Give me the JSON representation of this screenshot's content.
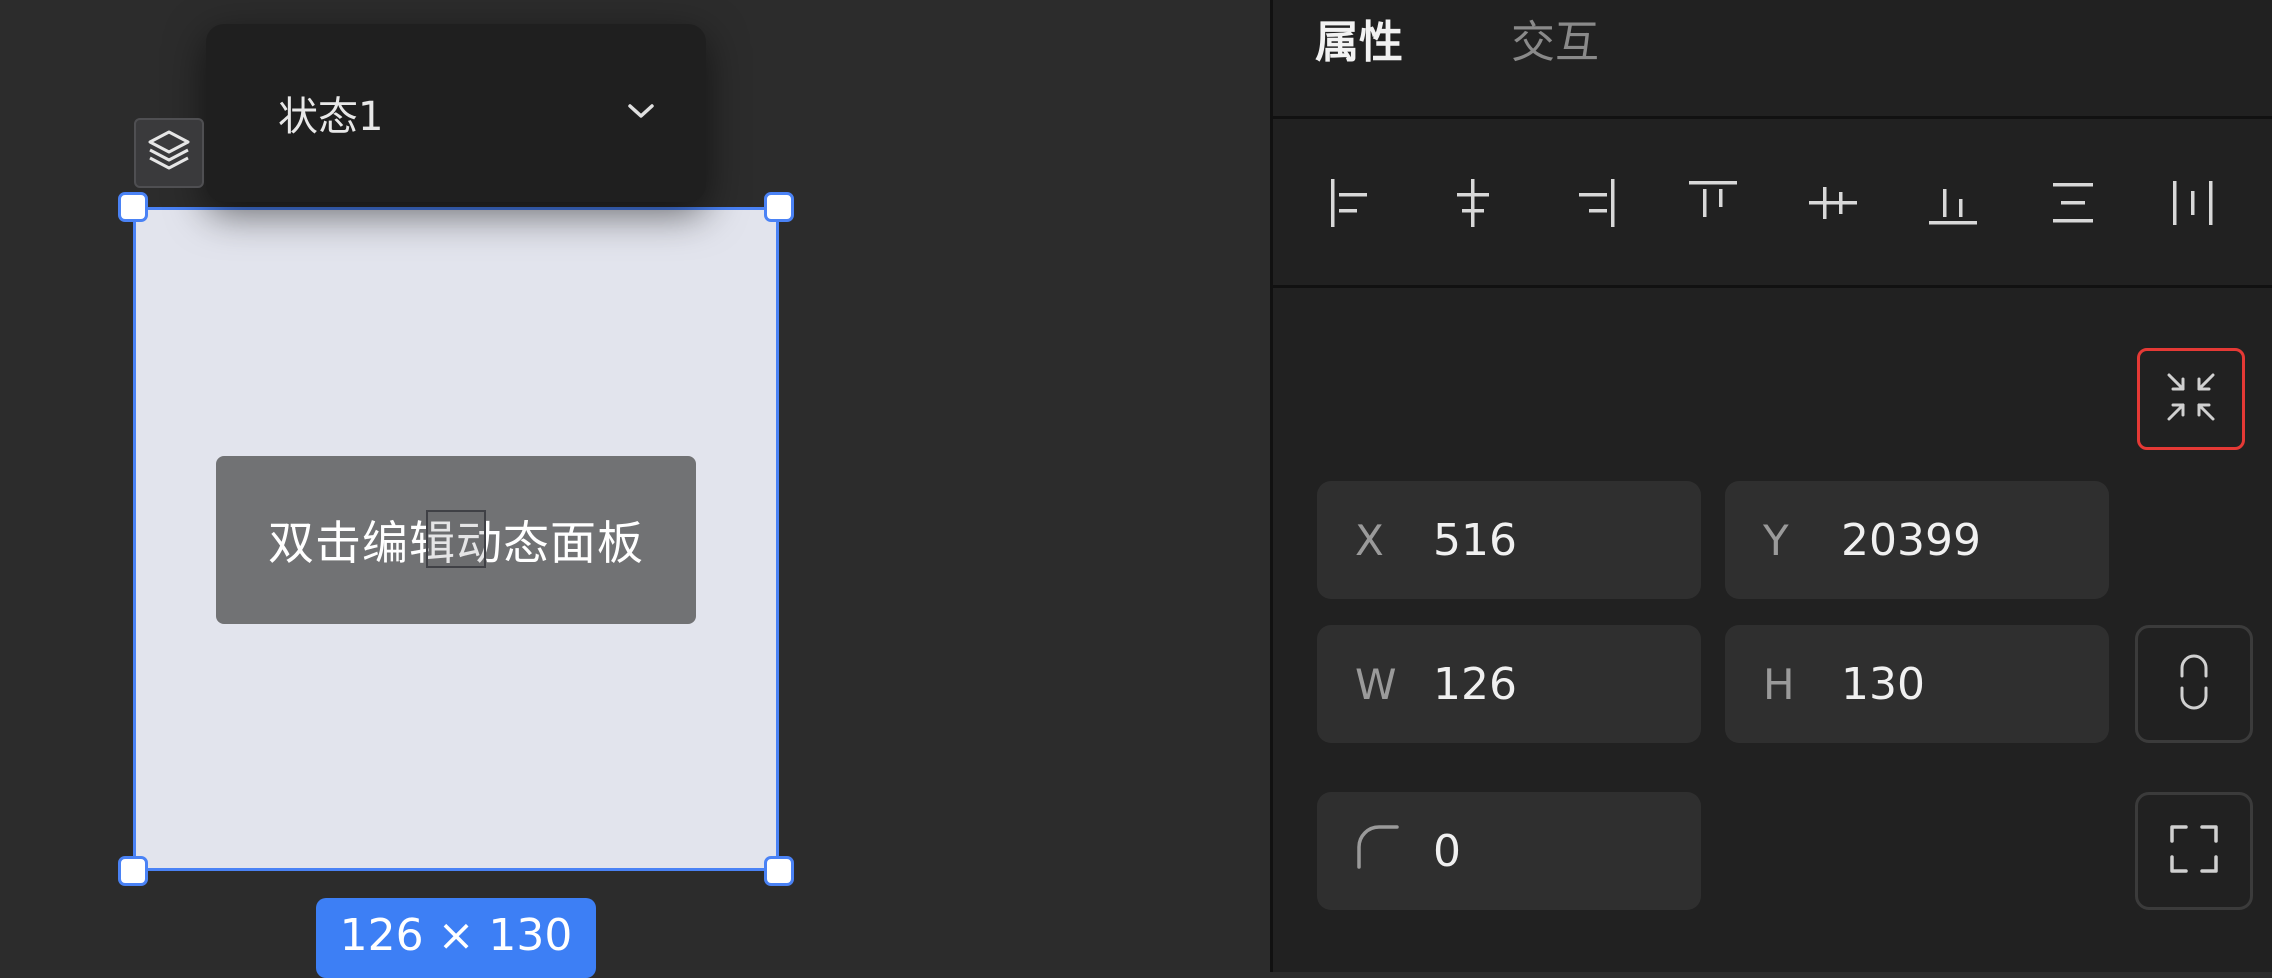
{
  "canvas": {
    "state_selector": {
      "label": "状态1"
    },
    "dynamic_panel": {
      "label": "双击编辑动态面板"
    },
    "size_badge": "126 × 130"
  },
  "panel": {
    "tabs": [
      {
        "label": "属性",
        "active": true
      },
      {
        "label": "交互",
        "active": false
      }
    ],
    "align_tools": [
      "align-left-icon",
      "align-horizontal-center-icon",
      "align-right-icon",
      "align-top-icon",
      "align-vertical-center-icon",
      "align-bottom-icon",
      "distribute-vertical-icon",
      "distribute-horizontal-icon"
    ],
    "fields": {
      "x": {
        "label": "X",
        "value": "516"
      },
      "y": {
        "label": "Y",
        "value": "20399"
      },
      "w": {
        "label": "W",
        "value": "126"
      },
      "h": {
        "label": "H",
        "value": "130"
      },
      "radius": {
        "value": "0"
      }
    }
  },
  "colors": {
    "accent": "#4a82f5",
    "highlight": "#e53935",
    "panel_bg": "#212121",
    "canvas_bg": "#2c2c2c"
  }
}
